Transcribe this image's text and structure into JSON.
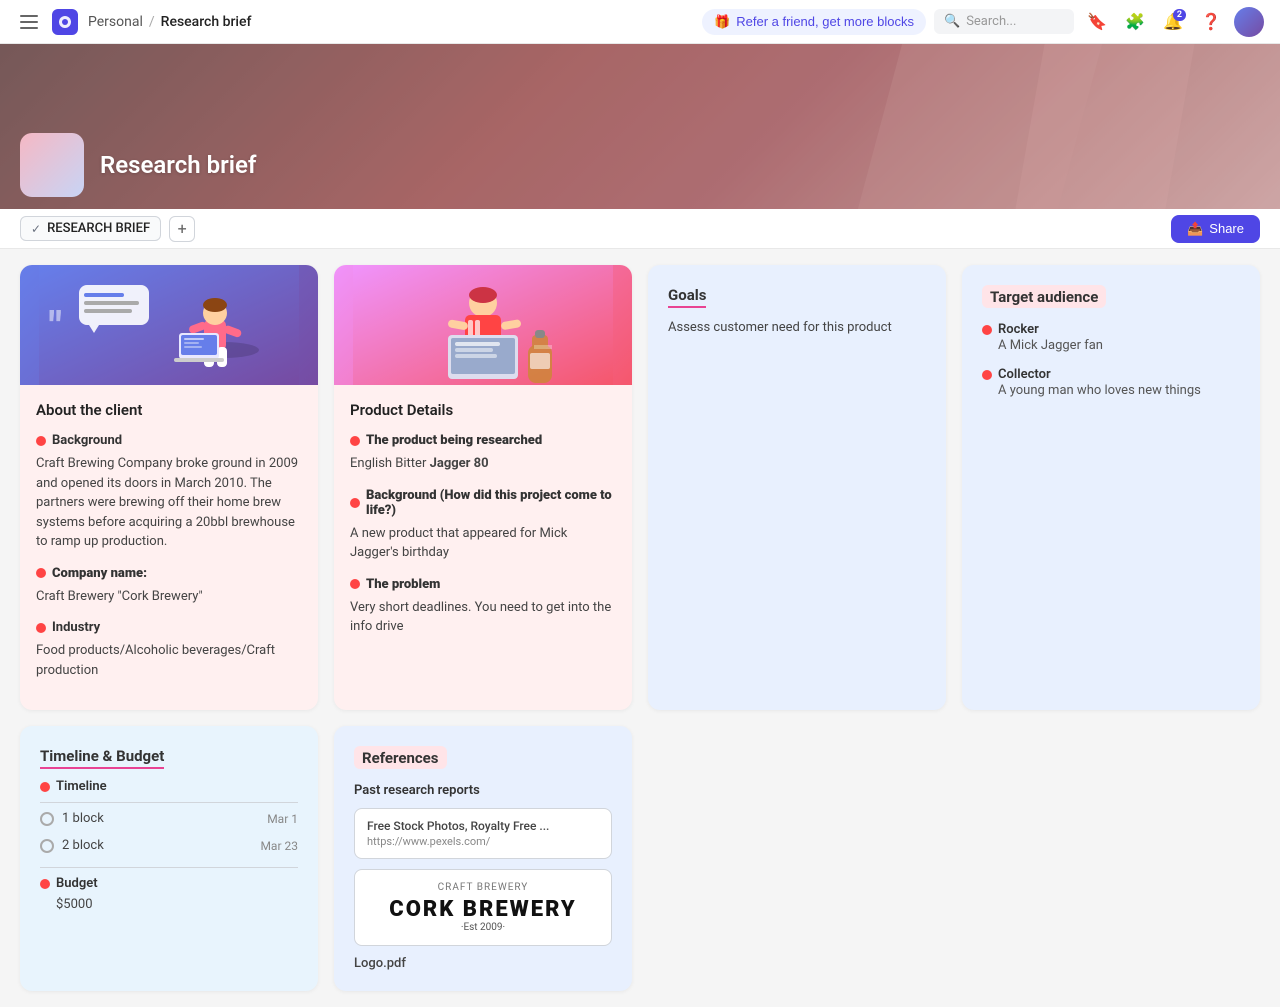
{
  "nav": {
    "workspace": "Personal",
    "separator": "/",
    "page": "Research brief",
    "refer_label": "Refer a friend, get more blocks",
    "search_placeholder": "Search...",
    "notification_badge": "2"
  },
  "hero": {
    "title": "Research brief"
  },
  "tabs": {
    "active_tab": "RESEARCH BRIEF",
    "add_label": "+",
    "share_label": "Share"
  },
  "about_client": {
    "title": "About the client",
    "background_label": "Background",
    "background_text": "Craft Brewing Company broke ground in 2009 and opened its doors in March 2010. The partners were brewing off their home brew systems before acquiring a 20bbl brewhouse to ramp up production.",
    "company_label": "Company name:",
    "company_text": "Craft Brewery \"Cork Brewery\"",
    "industry_label": "Industry",
    "industry_text": "Food products/Alcoholic beverages/Craft production"
  },
  "product_details": {
    "title": "Product Details",
    "product_label": "The product being researched",
    "product_text": "English Bitter",
    "product_name": "Jagger 80",
    "background_label": "Background (How did this project come to life?)",
    "background_text": "A new product that appeared for Mick Jagger's birthday",
    "problem_label": "The problem",
    "problem_text": "Very short deadlines. You need to get into the info drive"
  },
  "goals": {
    "title": "Goals",
    "text": "Assess customer need for this product"
  },
  "target_audience": {
    "title": "Target audience",
    "entries": [
      {
        "name": "Rocker",
        "desc": "A Mick Jagger fan"
      },
      {
        "name": "Collector",
        "desc": "A young man who loves new things"
      }
    ]
  },
  "timeline_budget": {
    "title": "Timeline & Budget",
    "timeline_label": "Timeline",
    "blocks": [
      {
        "label": "1 block",
        "date": "Mar 1"
      },
      {
        "label": "2 block",
        "date": "Mar 23"
      }
    ],
    "budget_label": "Budget",
    "budget_amount": "$5000"
  },
  "references": {
    "title": "References",
    "past_reports_label": "Past research reports",
    "link_title": "Free Stock Photos, Royalty Free ...",
    "link_url": "https://www.pexels.com/",
    "brewery_craft_label": "CRAFT BREWERY",
    "brewery_name": "CORK BREWERY",
    "brewery_est": "·Est 2009·",
    "logo_label": "Logo.pdf"
  },
  "icons": {
    "hamburger": "≡",
    "search": "🔍",
    "gift": "🎁",
    "bookmark": "🔖",
    "extensions": "🧩",
    "bell": "🔔",
    "help": "❓",
    "share_icon": "📤",
    "check": "✓",
    "dot_red": "●"
  }
}
